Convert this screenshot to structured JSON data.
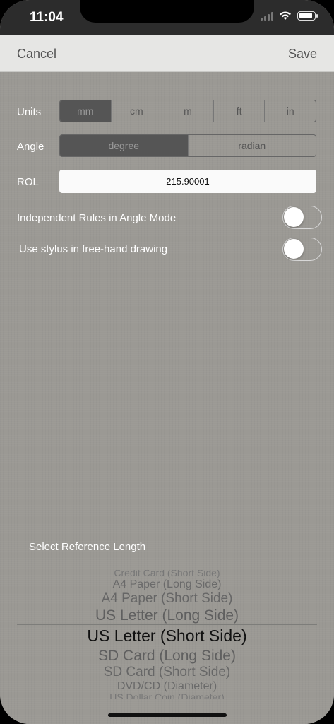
{
  "status": {
    "time": "11:04"
  },
  "nav": {
    "cancel": "Cancel",
    "save": "Save"
  },
  "units": {
    "label": "Units",
    "options": [
      "mm",
      "cm",
      "m",
      "ft",
      "in"
    ],
    "selected": "mm"
  },
  "angle": {
    "label": "Angle",
    "options": [
      "degree",
      "radian"
    ],
    "selected": "degree"
  },
  "rol": {
    "label": "ROL",
    "value": "215.90001"
  },
  "switches": [
    {
      "label": "Independent Rules in Angle Mode",
      "on": false
    },
    {
      "label": "Use stylus in free-hand drawing",
      "on": false
    }
  ],
  "picker": {
    "title": "Select Reference Length",
    "items": [
      "Credit Card (Short Side)",
      "A4 Paper (Long Side)",
      "A4 Paper (Short Side)",
      "US Letter (Long Side)",
      "US Letter (Short Side)",
      "SD Card (Long Side)",
      "SD Card (Short Side)",
      "DVD/CD (Diameter)",
      "US Dollar Coin (Diameter)"
    ],
    "selected": "US Letter (Short Side)"
  },
  "colors": {
    "background": "#9b9994",
    "navbar": "#e6e6e4",
    "segment_selected": "#555555"
  }
}
